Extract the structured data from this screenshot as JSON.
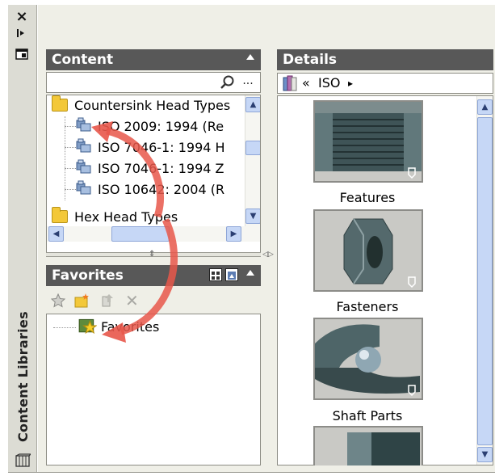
{
  "sidebar": {
    "title": "Content Libraries",
    "close_glyph": "×",
    "autohide_glyph": "⇹",
    "properties_glyph": "▤"
  },
  "content_panel": {
    "title": "Content",
    "search_value": "",
    "more_label": "...",
    "tree": [
      {
        "label": "Countersink Head Types",
        "kind": "folder"
      },
      {
        "label": "ISO 2009: 1994 (Re",
        "kind": "part"
      },
      {
        "label": "ISO 7046-1: 1994 H",
        "kind": "part"
      },
      {
        "label": "ISO 7046-1: 1994 Z",
        "kind": "part"
      },
      {
        "label": "ISO 10642: 2004 (R",
        "kind": "part"
      },
      {
        "label": "Hex Head Types",
        "kind": "folder"
      }
    ]
  },
  "favorites_panel": {
    "title": "Favorites",
    "tree": [
      {
        "label": "Favorites"
      }
    ],
    "toolbar_icons": [
      "favorites-star-icon",
      "new-folder-icon",
      "move-icon",
      "delete-icon"
    ]
  },
  "details_panel": {
    "title": "Details",
    "breadcrumb_prefix": "«",
    "breadcrumb_item": "ISO",
    "breadcrumb_suffix": "▸",
    "tiles": [
      {
        "label": "Features"
      },
      {
        "label": "Fasteners"
      },
      {
        "label": "Shaft Parts"
      }
    ]
  },
  "colors": {
    "panel_header": "#585858",
    "panel_bg": "#efefe7",
    "scroll_accent": "#c6d7f6",
    "annotation_arrow": "#e8574a",
    "folder": "#f3c839"
  }
}
